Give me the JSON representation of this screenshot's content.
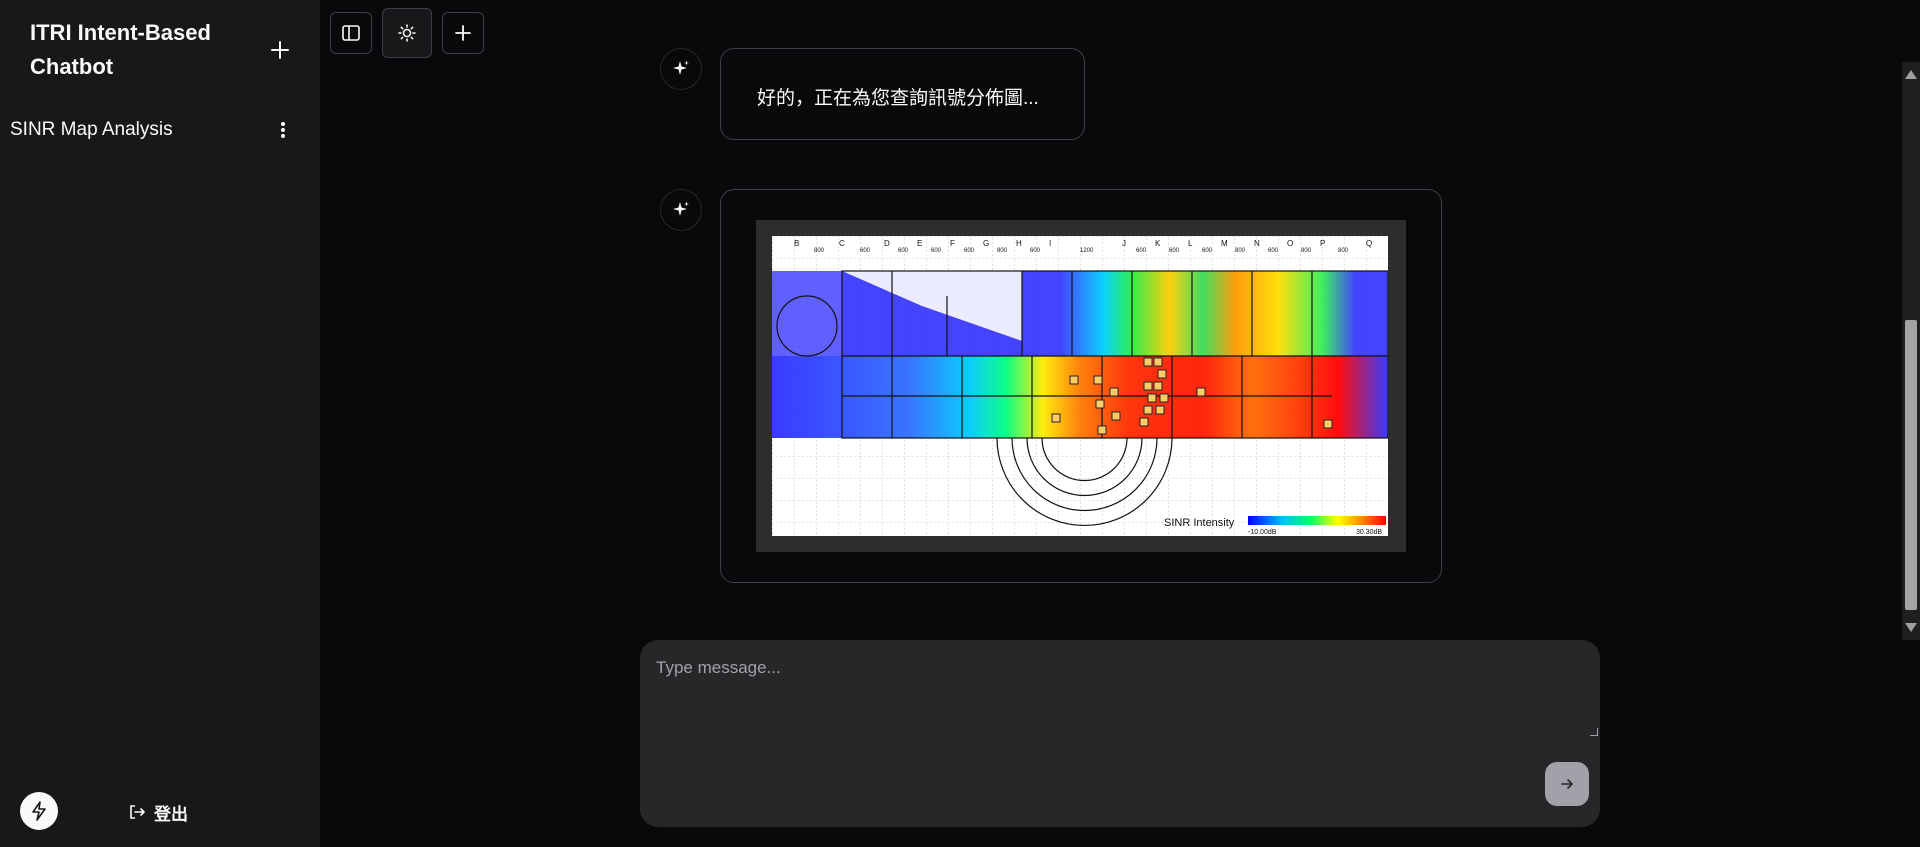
{
  "sidebar": {
    "app_title": "ITRI Intent-Based Chatbot",
    "chats": [
      {
        "label": "SINR Map Analysis"
      }
    ],
    "logout_label": "登出"
  },
  "toolbar": {
    "icons": [
      "sidebar-toggle-icon",
      "sun-icon",
      "plus-icon"
    ]
  },
  "messages": [
    {
      "role": "assistant",
      "text": "好的，正在為您查詢訊號分佈圖..."
    },
    {
      "role": "assistant",
      "type": "image",
      "image": {
        "legend_title": "SINR Intensity",
        "legend_min": "-10.00dB",
        "legend_max": "30.30dB",
        "column_labels": [
          "B",
          "C",
          "D",
          "E",
          "F",
          "G",
          "H",
          "I",
          "J",
          "K",
          "L",
          "M",
          "N",
          "O",
          "P",
          "Q"
        ],
        "dimension_labels": [
          "800",
          "600",
          "600",
          "600",
          "600",
          "800",
          "600",
          "1200",
          "600",
          "600",
          "600",
          "800",
          "600",
          "800",
          "800"
        ],
        "legend_colors": [
          "#0000ff",
          "#00bfff",
          "#00ff66",
          "#ffff00",
          "#ff8c00",
          "#ff0000"
        ]
      }
    }
  ],
  "composer": {
    "placeholder": "Type message..."
  },
  "colors": {
    "background": "#09090b",
    "sidebar": "#18181b",
    "composer": "#27272a"
  }
}
